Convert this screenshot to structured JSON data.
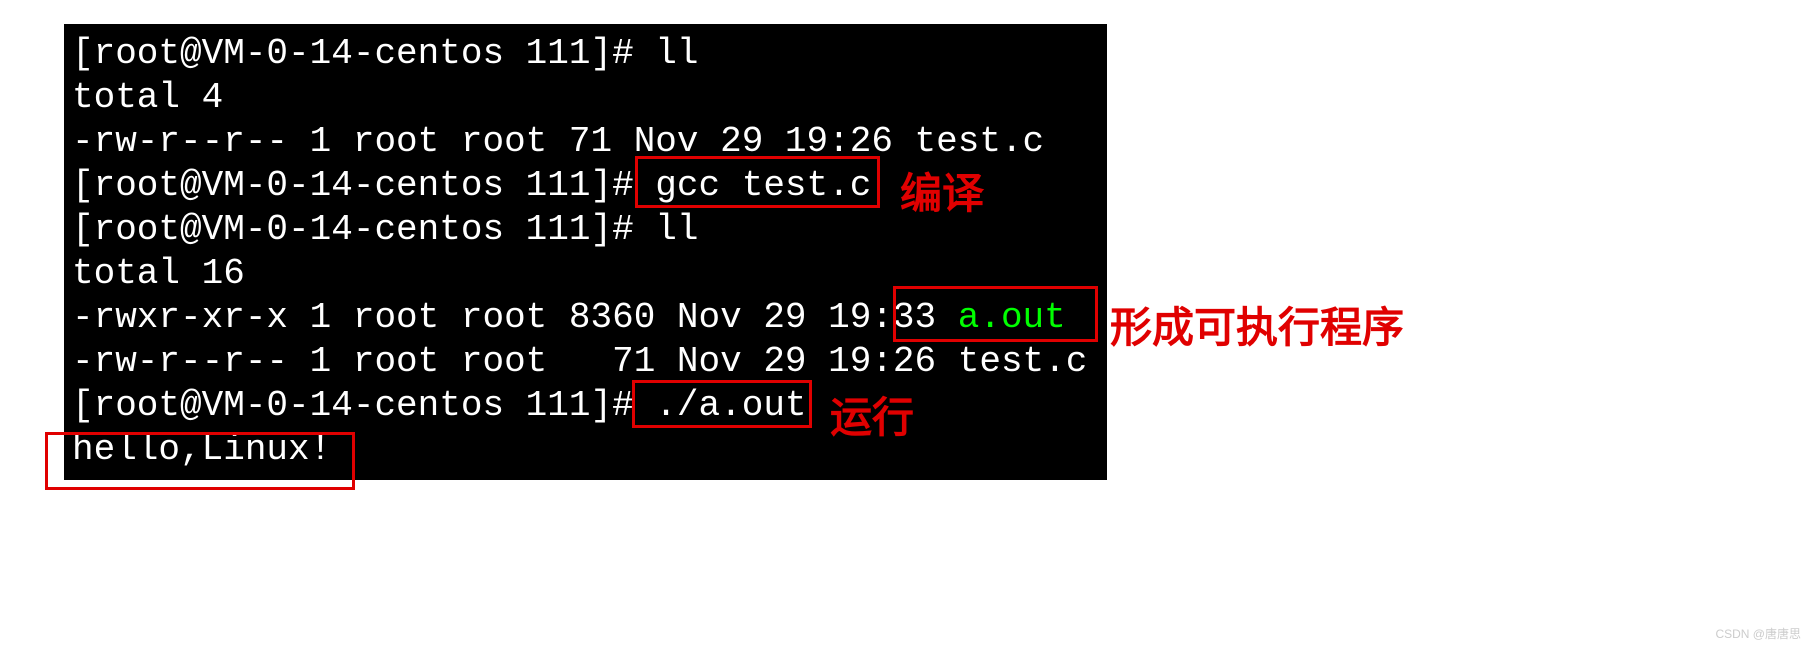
{
  "terminal": {
    "prompt": "[root@VM-0-14-centos 111]# ",
    "cmd_ll_1": "ll",
    "output_total_1": "total 4",
    "output_file_1": "-rw-r--r-- 1 root root 71 Nov 29 19:26 test.c",
    "cmd_gcc": "gcc test.c",
    "cmd_ll_2": "ll",
    "output_total_2": "total 16",
    "output_file_2a_prefix": "-rwxr-xr-x 1 root root 8360 Nov 29 19:33 ",
    "output_file_2a_name": "a.out",
    "output_file_2b": "-rw-r--r-- 1 root root   71 Nov 29 19:26 test.c",
    "cmd_run": "./a.out",
    "output_hello": "hello,Linux!"
  },
  "annotations": {
    "compile": "编译",
    "executable": "形成可执行程序",
    "run": "运行"
  },
  "watermark": "CSDN @唐唐思"
}
